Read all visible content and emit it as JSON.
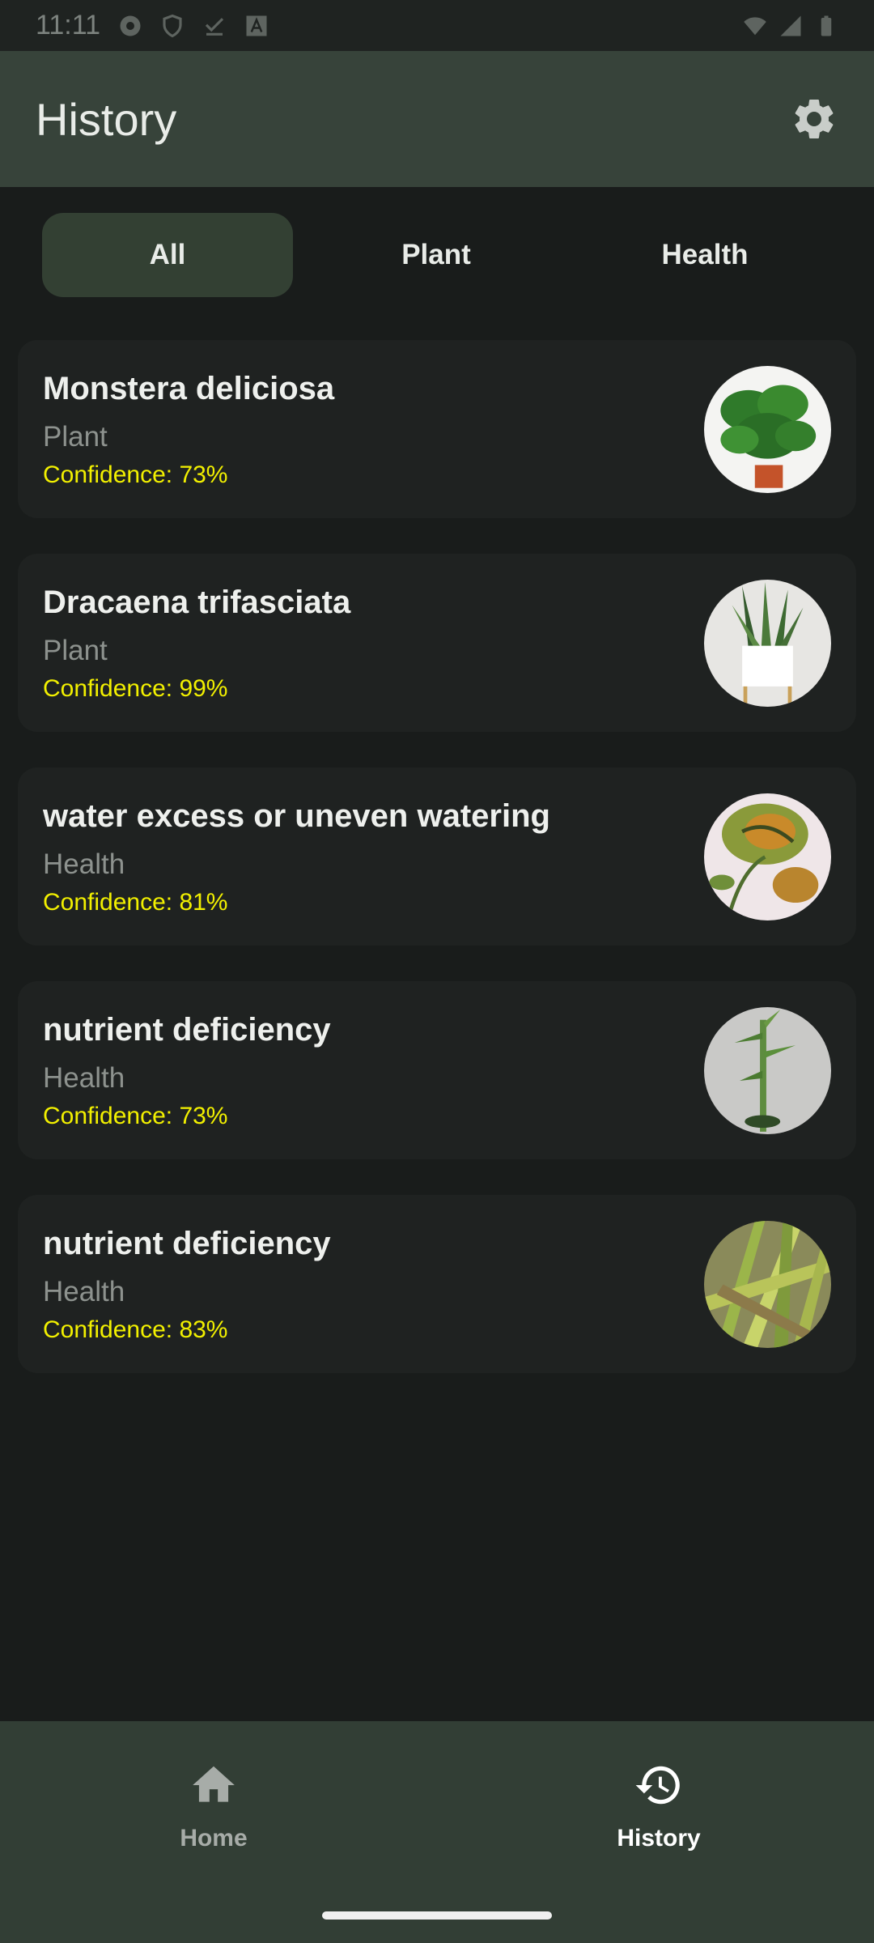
{
  "status_bar": {
    "time": "11:11"
  },
  "app_bar": {
    "title": "History",
    "settings_icon": "gear-icon"
  },
  "tabs": [
    {
      "label": "All",
      "selected": true
    },
    {
      "label": "Plant",
      "selected": false
    },
    {
      "label": "Health",
      "selected": false
    }
  ],
  "items": [
    {
      "name": "Monstera deliciosa",
      "category": "Plant",
      "confidence": "Confidence: 73%"
    },
    {
      "name": "Dracaena trifasciata",
      "category": "Plant",
      "confidence": "Confidence: 99%"
    },
    {
      "name": "water excess or uneven watering",
      "category": "Health",
      "confidence": "Confidence: 81%"
    },
    {
      "name": "nutrient deficiency",
      "category": "Health",
      "confidence": "Confidence: 73%"
    },
    {
      "name": "nutrient deficiency",
      "category": "Health",
      "confidence": "Confidence: 83%"
    }
  ],
  "bottom_nav": {
    "home": {
      "label": "Home",
      "icon": "home-icon"
    },
    "history": {
      "label": "History",
      "icon": "history-icon",
      "selected": true
    }
  },
  "colors": {
    "background": "#191c1b",
    "app_bar": "#37433a",
    "card": "#1f2221",
    "tab_active": "#334033",
    "confidence_text": "#f2f000",
    "bottom_nav": "#323e35"
  }
}
